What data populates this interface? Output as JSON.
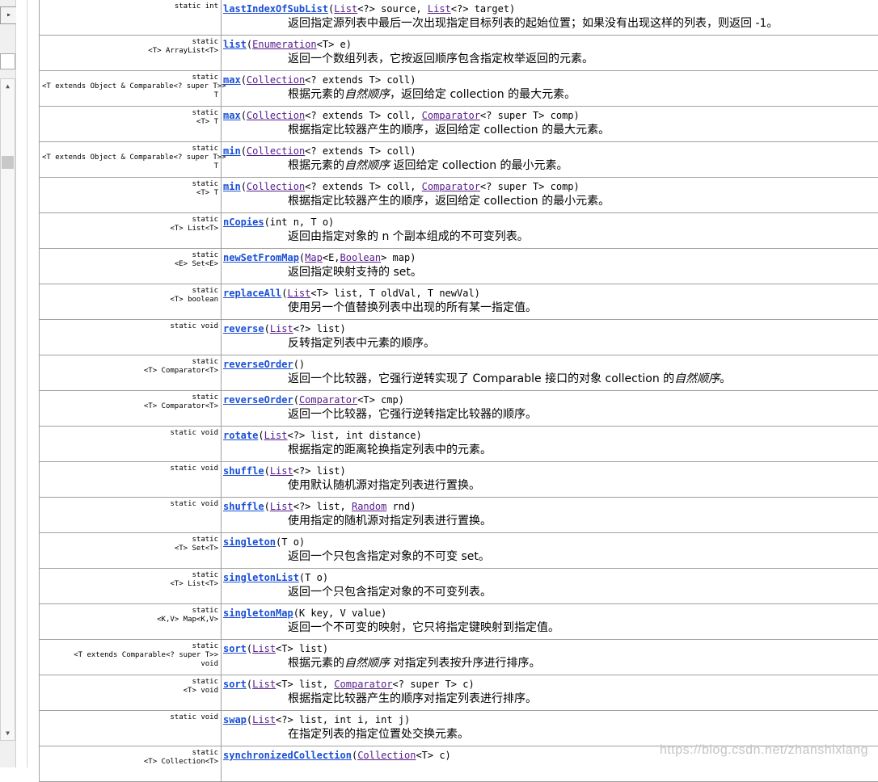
{
  "nav": {
    "arrow": "▸",
    "scroll_up": "▲",
    "scroll_down": "▼"
  },
  "methods": [
    {
      "mod": [
        "static int"
      ],
      "name": "lastIndexOfSubList",
      "sig": [
        [
          "(",
          ""
        ],
        [
          "List",
          "l"
        ],
        [
          "<?> source, ",
          ""
        ],
        [
          "List",
          "l"
        ],
        [
          "<?> target)",
          ""
        ]
      ],
      "desc": [
        [
          "返回指定源列表中最后一次出现指定目标列表的起始位置；如果没有出现这样的列表，则返回 -1。",
          ""
        ]
      ]
    },
    {
      "mod": [
        "static",
        "<T> ArrayList<T>"
      ],
      "name": "list",
      "sig": [
        [
          "(",
          ""
        ],
        [
          "Enumeration",
          "l"
        ],
        [
          "<T> e)",
          ""
        ]
      ],
      "desc": [
        [
          "返回一个数组列表，它按返回顺序包含指定枚举返回的元素。",
          ""
        ]
      ]
    },
    {
      "mod": [
        "static",
        "<T extends Object & Comparable<? super T>>",
        "T"
      ],
      "name": "max",
      "sig": [
        [
          "(",
          ""
        ],
        [
          "Collection",
          "l"
        ],
        [
          "<? extends T> coll)",
          ""
        ]
      ],
      "desc": [
        [
          "根据元素的",
          ""
        ],
        [
          "自然顺序",
          "i"
        ],
        [
          "，返回给定 collection 的最大元素。",
          ""
        ]
      ]
    },
    {
      "mod": [
        "static",
        "<T> T"
      ],
      "name": "max",
      "sig": [
        [
          "(",
          ""
        ],
        [
          "Collection",
          "l"
        ],
        [
          "<? extends T> coll, ",
          ""
        ],
        [
          "Comparator",
          "l"
        ],
        [
          "<? super T> comp)",
          ""
        ]
      ],
      "desc": [
        [
          "根据指定比较器产生的顺序，返回给定 collection 的最大元素。",
          ""
        ]
      ]
    },
    {
      "mod": [
        "static",
        "<T extends Object & Comparable<? super T>>",
        "T"
      ],
      "name": "min",
      "sig": [
        [
          "(",
          ""
        ],
        [
          "Collection",
          "l"
        ],
        [
          "<? extends T> coll)",
          ""
        ]
      ],
      "desc": [
        [
          "根据元素的",
          ""
        ],
        [
          "自然顺序",
          "i"
        ],
        [
          " 返回给定 collection 的最小元素。",
          ""
        ]
      ]
    },
    {
      "mod": [
        "static",
        "<T> T"
      ],
      "name": "min",
      "sig": [
        [
          "(",
          ""
        ],
        [
          "Collection",
          "l"
        ],
        [
          "<? extends T> coll, ",
          ""
        ],
        [
          "Comparator",
          "l"
        ],
        [
          "<? super T> comp)",
          ""
        ]
      ],
      "desc": [
        [
          "根据指定比较器产生的顺序，返回给定 collection 的最小元素。",
          ""
        ]
      ]
    },
    {
      "mod": [
        "static",
        "<T> List<T>"
      ],
      "name": "nCopies",
      "sig": [
        [
          "(int n, T o)",
          ""
        ]
      ],
      "desc": [
        [
          "返回由指定对象的 n 个副本组成的不可变列表。",
          ""
        ]
      ]
    },
    {
      "mod": [
        "static",
        "<E> Set<E>"
      ],
      "name": "newSetFromMap",
      "sig": [
        [
          "(",
          ""
        ],
        [
          "Map",
          "l"
        ],
        [
          "<E,",
          ""
        ],
        [
          "Boolean",
          "l"
        ],
        [
          "> map)",
          ""
        ]
      ],
      "desc": [
        [
          "返回指定映射支持的 set。",
          ""
        ]
      ]
    },
    {
      "mod": [
        "static",
        "<T> boolean"
      ],
      "name": "replaceAll",
      "sig": [
        [
          "(",
          ""
        ],
        [
          "List",
          "l"
        ],
        [
          "<T> list, T oldVal, T newVal)",
          ""
        ]
      ],
      "desc": [
        [
          "使用另一个值替换列表中出现的所有某一指定值。",
          ""
        ]
      ]
    },
    {
      "mod": [
        "static void"
      ],
      "name": "reverse",
      "sig": [
        [
          "(",
          ""
        ],
        [
          "List",
          "l"
        ],
        [
          "<?> list)",
          ""
        ]
      ],
      "desc": [
        [
          "反转指定列表中元素的顺序。",
          ""
        ]
      ]
    },
    {
      "mod": [
        "static",
        "<T> Comparator<T>"
      ],
      "name": "reverseOrder",
      "sig": [
        [
          "()",
          ""
        ]
      ],
      "desc": [
        [
          "返回一个比较器，它强行逆转实现了 Comparable 接口的对象 collection 的",
          ""
        ],
        [
          "自然顺序",
          "i"
        ],
        [
          "。",
          ""
        ]
      ]
    },
    {
      "mod": [
        "static",
        "<T> Comparator<T>"
      ],
      "name": "reverseOrder",
      "sig": [
        [
          "(",
          ""
        ],
        [
          "Comparator",
          "l"
        ],
        [
          "<T> cmp)",
          ""
        ]
      ],
      "desc": [
        [
          "返回一个比较器，它强行逆转指定比较器的顺序。",
          ""
        ]
      ]
    },
    {
      "mod": [
        "static void"
      ],
      "name": "rotate",
      "sig": [
        [
          "(",
          ""
        ],
        [
          "List",
          "l"
        ],
        [
          "<?> list, int distance)",
          ""
        ]
      ],
      "desc": [
        [
          "根据指定的距离轮换指定列表中的元素。",
          ""
        ]
      ]
    },
    {
      "mod": [
        "static void"
      ],
      "name": "shuffle",
      "sig": [
        [
          "(",
          ""
        ],
        [
          "List",
          "l"
        ],
        [
          "<?> list)",
          ""
        ]
      ],
      "desc": [
        [
          "使用默认随机源对指定列表进行置换。",
          ""
        ]
      ]
    },
    {
      "mod": [
        "static void"
      ],
      "name": "shuffle",
      "sig": [
        [
          "(",
          ""
        ],
        [
          "List",
          "l"
        ],
        [
          "<?> list, ",
          ""
        ],
        [
          "Random",
          "l"
        ],
        [
          " rnd)",
          ""
        ]
      ],
      "desc": [
        [
          "使用指定的随机源对指定列表进行置换。",
          ""
        ]
      ]
    },
    {
      "mod": [
        "static",
        "<T> Set<T>"
      ],
      "name": "singleton",
      "sig": [
        [
          "(T o)",
          ""
        ]
      ],
      "desc": [
        [
          "返回一个只包含指定对象的不可变 set。",
          ""
        ]
      ]
    },
    {
      "mod": [
        "static",
        "<T> List<T>"
      ],
      "name": "singletonList",
      "sig": [
        [
          "(T o)",
          ""
        ]
      ],
      "desc": [
        [
          "返回一个只包含指定对象的不可变列表。",
          ""
        ]
      ]
    },
    {
      "mod": [
        "static",
        "<K,V> Map<K,V>"
      ],
      "name": "singletonMap",
      "sig": [
        [
          "(K key, V value)",
          ""
        ]
      ],
      "desc": [
        [
          "返回一个不可变的映射，它只将指定键映射到指定值。",
          ""
        ]
      ]
    },
    {
      "mod": [
        "static",
        "<T extends Comparable<? super T>>",
        "void"
      ],
      "name": "sort",
      "sig": [
        [
          "(",
          ""
        ],
        [
          "List",
          "l"
        ],
        [
          "<T> list)",
          ""
        ]
      ],
      "desc": [
        [
          "根据元素的",
          ""
        ],
        [
          "自然顺序",
          "i"
        ],
        [
          " 对指定列表按升序进行排序。",
          ""
        ]
      ]
    },
    {
      "mod": [
        "static",
        "<T> void"
      ],
      "name": "sort",
      "sig": [
        [
          "(",
          ""
        ],
        [
          "List",
          "l"
        ],
        [
          "<T> list, ",
          ""
        ],
        [
          "Comparator",
          "l"
        ],
        [
          "<? super T> c)",
          ""
        ]
      ],
      "desc": [
        [
          "根据指定比较器产生的顺序对指定列表进行排序。",
          ""
        ]
      ]
    },
    {
      "mod": [
        "static void"
      ],
      "name": "swap",
      "sig": [
        [
          "(",
          ""
        ],
        [
          "List",
          "l"
        ],
        [
          "<?> list, int i, int j)",
          ""
        ]
      ],
      "desc": [
        [
          "在指定列表的指定位置处交换元素。",
          ""
        ]
      ]
    },
    {
      "mod": [
        "static",
        "<T> Collection<T>"
      ],
      "name": "synchronizedCollection",
      "sig": [
        [
          "(",
          ""
        ],
        [
          "Collection",
          "l"
        ],
        [
          "<T> c)",
          ""
        ]
      ],
      "desc": [
        [
          "",
          ""
        ]
      ]
    }
  ],
  "watermark": "https://blog.csdn.net/zhanshixiang"
}
